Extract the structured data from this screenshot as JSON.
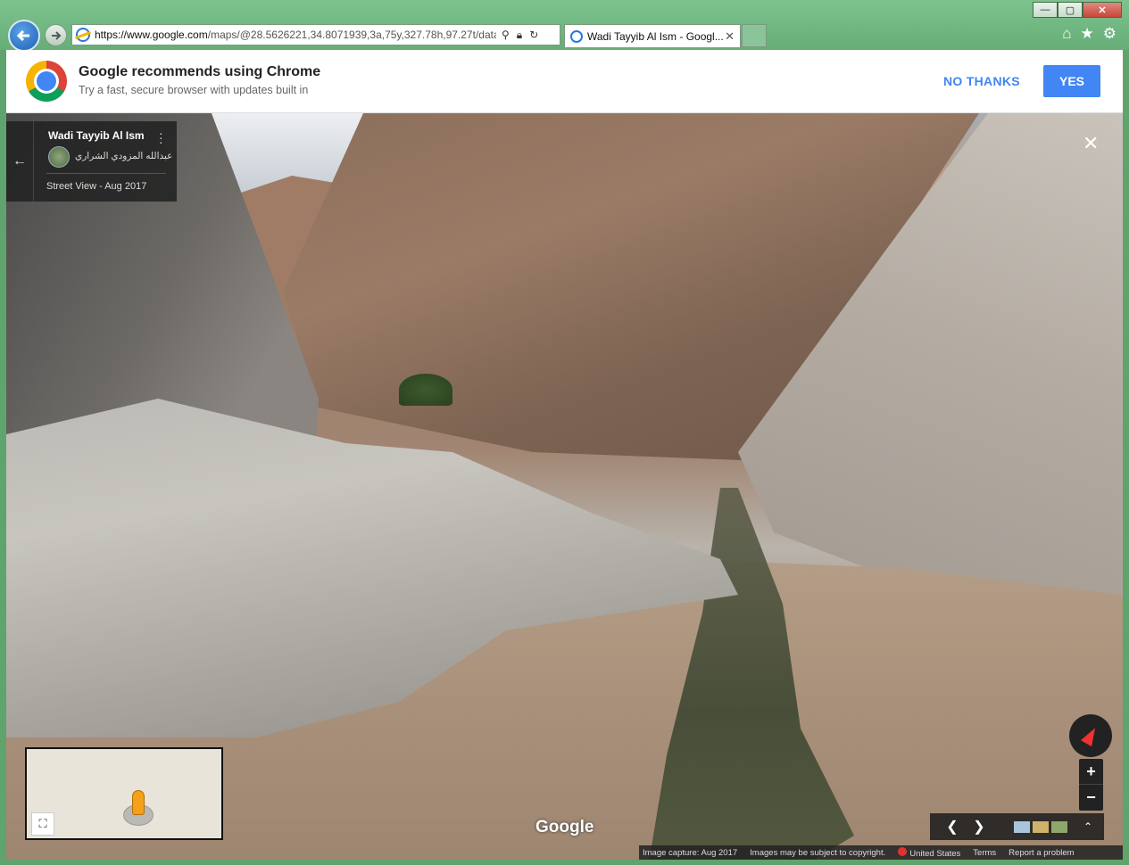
{
  "browser": {
    "address_url_host": "https://www.google.com",
    "address_url_path": "/maps/@28.5626221,34.8071939,3a,75y,327.78h,97.27t/data=!",
    "tab_title": "Wadi Tayyib Al Ism - Googl...",
    "tab_close": "✕",
    "window_minimize": "—",
    "window_maximize": "▢",
    "window_close": "✕",
    "home_icon": "home-icon",
    "favorites_icon": "star-icon",
    "tools_icon": "gear-icon"
  },
  "promo": {
    "title": "Google recommends using Chrome",
    "subtitle": "Try a fast, secure browser with updates built in",
    "no_thanks": "NO THANKS",
    "yes": "YES"
  },
  "street_view": {
    "place_name": "Wadi Tayyib Al Ism",
    "author": "عبدالله المزودي الشراري",
    "date_line": "Street View - Aug 2017",
    "google_logo": "Google",
    "close": "✕",
    "back": "←",
    "menu": "⋮",
    "zoom_in": "+",
    "zoom_out": "−",
    "expand": "⛶",
    "prev": "❮",
    "next": "❯",
    "collapse": "⌃",
    "footer": {
      "capture": "Image capture: Aug 2017",
      "copyright": "Images may be subject to copyright.",
      "country": "United States",
      "terms": "Terms",
      "report": "Report a problem"
    }
  },
  "colors": {
    "accent_blue": "#4285f4",
    "frame_green": "#6fb27e",
    "overlay_dark": "#222222"
  }
}
